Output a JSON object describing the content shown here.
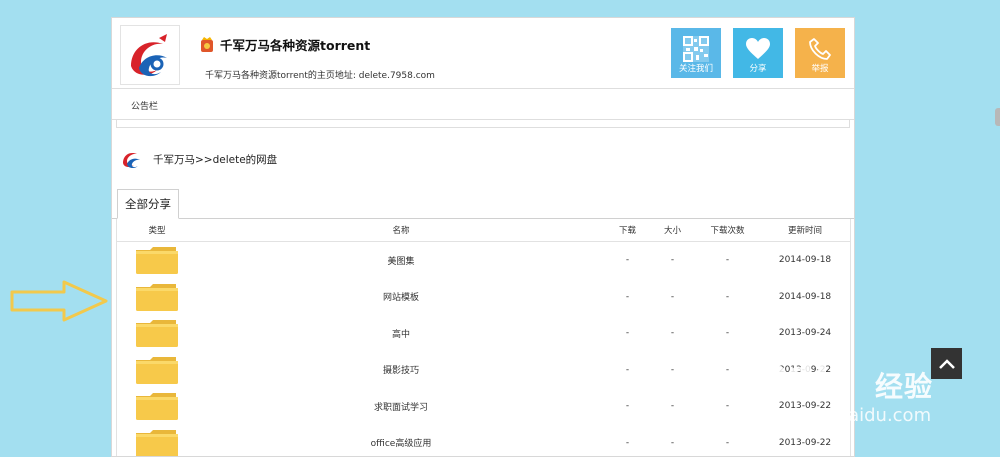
{
  "header": {
    "site_title": "千军万马各种资源torrent",
    "subtitle": "千军万马各种资源torrent的主页地址:  delete.7958.com",
    "actions": [
      {
        "label": "关注我们",
        "icon": "qrcode-icon"
      },
      {
        "label": "分享",
        "icon": "heart-icon"
      },
      {
        "label": "举报",
        "icon": "phone-icon"
      }
    ]
  },
  "notice": {
    "label": "公告栏"
  },
  "breadcrumb": {
    "text": "千军万马>>delete的网盘"
  },
  "tabs": [
    {
      "label": "全部分享",
      "active": true
    }
  ],
  "table": {
    "headers": {
      "type": "类型",
      "name": "名称",
      "downloads": "下载",
      "size": "大小",
      "download_count": "下载次数",
      "updated": "更新时间"
    },
    "rows": [
      {
        "name": "美图集",
        "downloads": "-",
        "size": "-",
        "download_count": "-",
        "updated": "2014-09-18"
      },
      {
        "name": "网站模板",
        "downloads": "-",
        "size": "-",
        "download_count": "-",
        "updated": "2014-09-18"
      },
      {
        "name": "高中",
        "downloads": "-",
        "size": "-",
        "download_count": "-",
        "updated": "2013-09-24"
      },
      {
        "name": "摄影技巧",
        "downloads": "-",
        "size": "-",
        "download_count": "-",
        "updated": "2013-09-22"
      },
      {
        "name": "求职面试学习",
        "downloads": "-",
        "size": "-",
        "download_count": "-",
        "updated": "2013-09-22"
      },
      {
        "name": "office高级应用",
        "downloads": "-",
        "size": "-",
        "download_count": "-",
        "updated": "2013-09-22"
      }
    ]
  },
  "watermark": {
    "brand": "经验",
    "url": "jingyan.baidu.com",
    "mark": "Bai"
  },
  "colors": {
    "background": "#a3dff0",
    "follow_button": "#5ab8e8",
    "share_button": "#42b8e6",
    "report_button": "#f5b24b",
    "folder": "#f7c94a",
    "arrow": "#f2c94c"
  }
}
